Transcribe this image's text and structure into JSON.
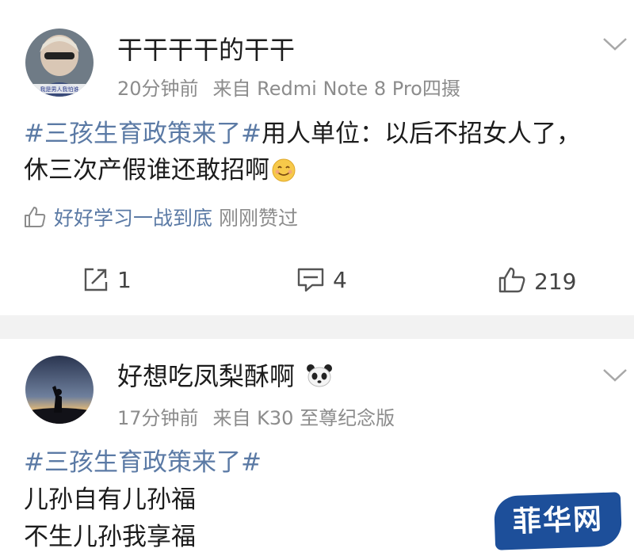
{
  "posts": [
    {
      "username": "干干干干的干干",
      "time": "20分钟前",
      "source": "来自 Redmi Note 8 Pro四摄",
      "hashtag": "#三孩生育政策来了#",
      "text_line1": "用人单位：以后不招女人了，",
      "text_line2": "休三次产假谁还敢招啊",
      "liker_name": "好好学习一战到底",
      "liker_suffix": "刚刚赞过",
      "shares": "1",
      "comments": "4",
      "likes": "219",
      "avatar_badge_text": "我是男人我怕谁"
    },
    {
      "username": "好想吃凤梨酥啊",
      "time": "17分钟前",
      "source": "来自 K30 至尊纪念版",
      "hashtag": "#三孩生育政策来了#",
      "line1": "儿孙自有儿孙福",
      "line2": "不生儿孙我享福"
    }
  ],
  "watermark": "菲华网",
  "colors": {
    "link": "#5b7aa5",
    "meta": "#8c8c8c",
    "divider": "#f2f2f2",
    "watermark_bg": "#1d4f9a"
  },
  "icons": [
    "chevron-down-icon",
    "thumbs-up-icon",
    "share-icon",
    "comment-icon",
    "like-icon",
    "smile-emoji-icon",
    "panda-emoji-icon"
  ]
}
